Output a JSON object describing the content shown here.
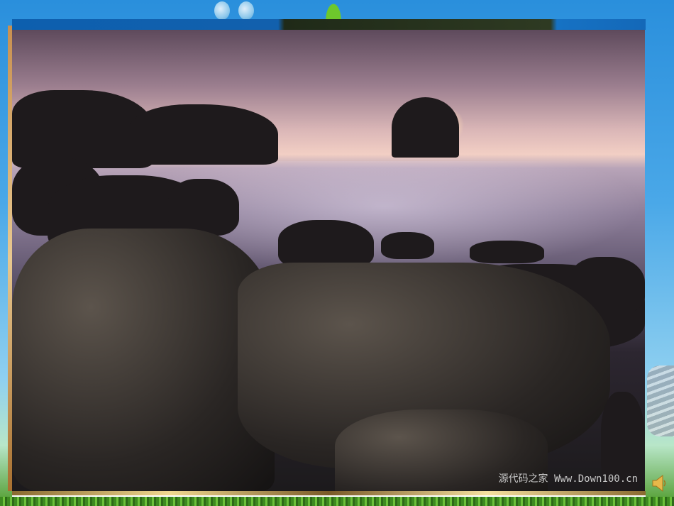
{
  "slide": {
    "watermark": "源代码之家 Www.Down100.cn",
    "icons": [
      "speaker-icon"
    ]
  }
}
